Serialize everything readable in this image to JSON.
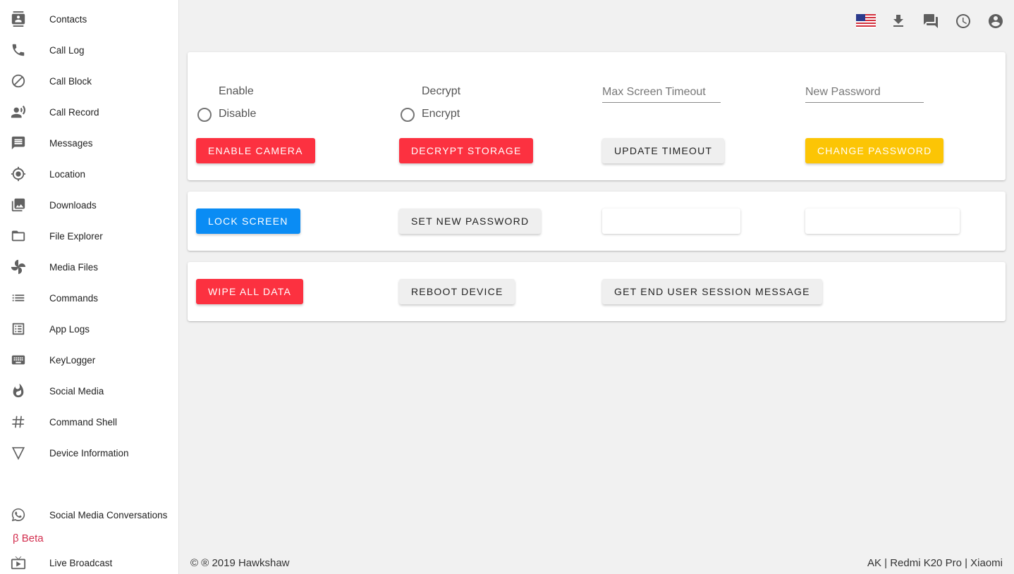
{
  "sidebar": {
    "items": [
      {
        "label": "Contacts",
        "icon": "contacts-icon"
      },
      {
        "label": "Call Log",
        "icon": "phone-icon"
      },
      {
        "label": "Call Block",
        "icon": "block-icon"
      },
      {
        "label": "Call Record",
        "icon": "record-voice-icon"
      },
      {
        "label": "Messages",
        "icon": "message-icon"
      },
      {
        "label": "Location",
        "icon": "location-icon"
      },
      {
        "label": "Downloads",
        "icon": "photo-library-icon"
      },
      {
        "label": "File Explorer",
        "icon": "folder-icon"
      },
      {
        "label": "Media Files",
        "icon": "pinwheel-icon"
      },
      {
        "label": "Commands",
        "icon": "list-icon"
      },
      {
        "label": "App Logs",
        "icon": "log-list-icon"
      },
      {
        "label": "KeyLogger",
        "icon": "keyboard-icon"
      },
      {
        "label": "Social Media",
        "icon": "flame-icon"
      },
      {
        "label": "Command Shell",
        "icon": "hash-icon"
      },
      {
        "label": "Device Information",
        "icon": "triangle-icon"
      },
      {
        "label": "Social Media Conversations",
        "icon": "whatsapp-icon"
      },
      {
        "label": "Live Broadcast",
        "icon": "live-tv-icon"
      }
    ],
    "beta_label": "β Beta"
  },
  "topbar": {
    "icons": [
      "us-flag-icon",
      "download-icon",
      "forum-icon",
      "clock-icon",
      "account-icon"
    ]
  },
  "card1": {
    "camera_enable_label": "Enable",
    "camera_disable_label": "Disable",
    "storage_decrypt_label": "Decrypt",
    "storage_encrypt_label": "Encrypt",
    "timeout_placeholder": "Max Screen Timeout",
    "password_placeholder": "New Password",
    "enable_camera_button": "ENABLE CAMERA",
    "decrypt_storage_button": "DECRYPT STORAGE",
    "update_timeout_button": "UPDATE TIMEOUT",
    "change_password_button": "CHANGE PASSWORD"
  },
  "card2": {
    "lock_screen_button": "LOCK SCREEN",
    "set_new_password_button": "SET NEW PASSWORD"
  },
  "card3": {
    "wipe_button": "WIPE ALL DATA",
    "reboot_button": "REBOOT DEVICE",
    "session_button": "GET END USER SESSION MESSAGE"
  },
  "footer": {
    "copyright": "© ® 2019 Hawkshaw",
    "device": "AK | Redmi K20 Pro | Xiaomi"
  },
  "colors": {
    "red": "#fc3140",
    "blue": "#0a8cf4",
    "yellow": "#fcc505",
    "beta": "#d32f4f"
  }
}
